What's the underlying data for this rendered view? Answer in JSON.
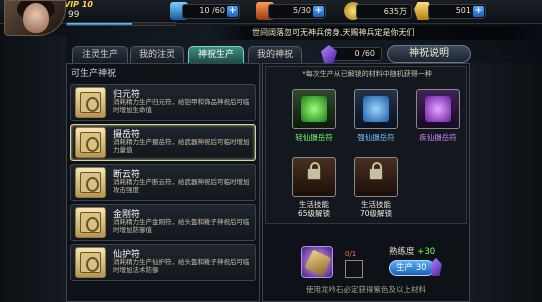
{
  "player": {
    "vip": "VIP 10",
    "level": "99",
    "exp_fraction": 0.6
  },
  "stats": [
    {
      "value": "10 /60",
      "icon": "energy-icon"
    },
    {
      "value": "5/30",
      "icon": "stamina-icon"
    },
    {
      "value": "635万",
      "icon": "gold-coin-icon"
    },
    {
      "value": "501",
      "icon": "ingot-icon"
    }
  ],
  "marquee": "世间阔落忽可无神兵傍身,天赐神兵定是你无们",
  "tabs": [
    {
      "label": "注灵生产",
      "active": false
    },
    {
      "label": "我的注灵",
      "active": false
    },
    {
      "label": "神祝生产",
      "active": true
    },
    {
      "label": "我的神祝",
      "active": false
    }
  ],
  "counter": "0 /60",
  "help_label": "神祝说明",
  "left": {
    "title": "可生产神祝",
    "items": [
      {
        "name": "归元符",
        "desc": "消耗精力生产归元符，给铠甲和饰品神祝后可临时增加生命值",
        "selected": false
      },
      {
        "name": "摄岳符",
        "desc": "消耗精力生产摄岳符，给武器神祝后可临时增加力量值",
        "selected": true
      },
      {
        "name": "断云符",
        "desc": "消耗精力生产断云符，给武器神祝后可临时增加攻击强度",
        "selected": false
      },
      {
        "name": "金刚符",
        "desc": "消耗精力生产金刚符，给头盔和靴子神祝后可临时增加防御值",
        "selected": false
      },
      {
        "name": "仙护符",
        "desc": "消耗精力生产仙护符，给头盔和靴子神祝后可临时增加法术防御",
        "selected": false
      }
    ]
  },
  "right": {
    "note": "*每次生产从已解锁的材料中随机获得一种",
    "results": [
      {
        "label": "轻仙摄岳符",
        "color": "green"
      },
      {
        "label": "强仙摄岳符",
        "color": "blue"
      },
      {
        "label": "疾仙摄岳符",
        "color": "purple"
      },
      {
        "label_line1": "生活技能",
        "label_line2": "65级解锁",
        "color": "locked"
      },
      {
        "label_line1": "生活技能",
        "label_line2": "70级解锁",
        "color": "locked"
      }
    ],
    "mat_count": "0/1",
    "proficiency_label": "熟练度",
    "proficiency_value": "+30",
    "produce_label": "生产 30",
    "footnote": "使用龙吟石必定获得紫色及以上材料"
  }
}
